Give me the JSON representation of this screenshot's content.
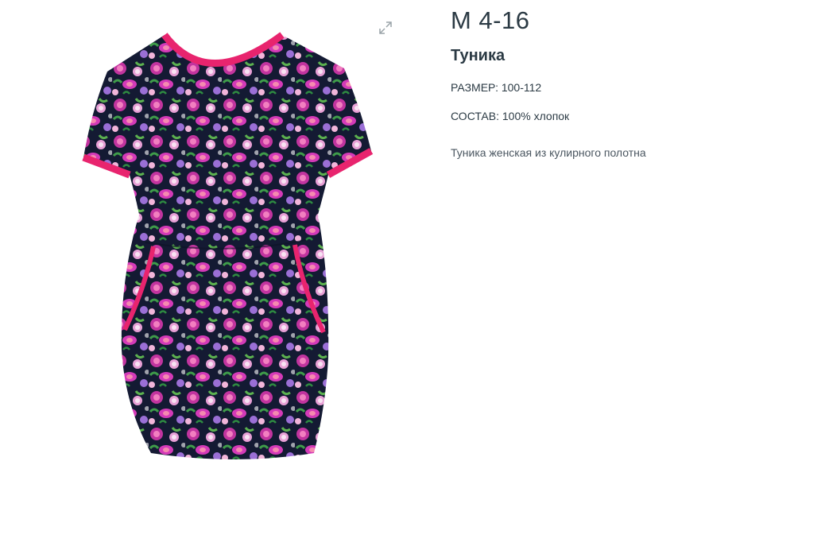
{
  "product": {
    "sku": "М 4-16",
    "name": "Туника",
    "size_line": "РАЗМЕР: 100-112",
    "composition_line": "СОСТАВ: 100% хлопок",
    "description": "Туника женская из кулирного полотна"
  },
  "image": {
    "subject": "floral-tunic-photo",
    "zoom_icon": "expand-icon"
  },
  "colors": {
    "text": "#2b3a44",
    "trim_pink": "#e8246e",
    "fabric_navy": "#141a33",
    "flower_magenta": "#d43ab8",
    "flower_pink": "#f08ac4"
  }
}
